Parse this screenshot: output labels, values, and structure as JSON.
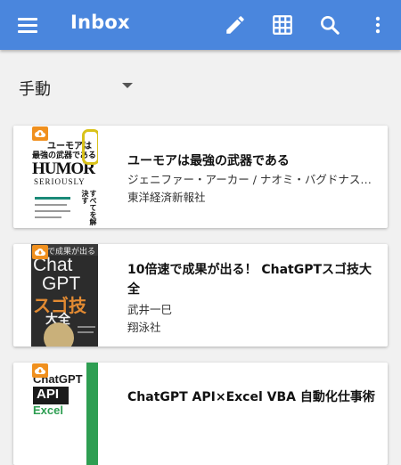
{
  "appbar": {
    "title": "Inbox",
    "menu_icon": "hamburger-menu-icon",
    "actions": [
      "edit-pencil-icon",
      "grid-view-icon",
      "search-icon",
      "more-vert-icon"
    ],
    "color": "#4a86dd"
  },
  "sort": {
    "label": "手動",
    "dropdown_icon": "caret-down-icon"
  },
  "books": [
    {
      "title": "ユーモアは最強の武器である",
      "author": "ジェニファー・アーカー / ナオミ・バグドナス…",
      "publisher": "東洋経済新報社",
      "badge_icon": "cloud-download-icon",
      "cover": {
        "line1": "ユーモアは",
        "line2": "最強の武器である",
        "main": "HUMOR",
        "sub": "SERIOUSLY",
        "tag": "すべてを解決す",
        "colors": [
          "#ffffff",
          "#111111",
          "#d9c21a",
          "#1a8a78"
        ]
      }
    },
    {
      "title": "10倍速で成果が出る！ ChatGPTスゴ技大全",
      "author": "武井一巳",
      "publisher": "翔泳社",
      "badge_icon": "cloud-download-icon",
      "cover": {
        "top": "で成果が出る",
        "main1": "Chat",
        "main2": "GPT",
        "jp": "スゴ技",
        "big": "大全",
        "colors": [
          "#2c2c2c",
          "#f2f2f2",
          "#e28a32",
          "#c9b07a"
        ]
      }
    },
    {
      "title": "ChatGPT API×Excel VBA 自動化仕事術",
      "author": "",
      "publisher": "",
      "badge_icon": "cloud-download-icon",
      "cover": {
        "main1": "ChatGPT",
        "main2": "API",
        "main3": "Excel",
        "colors": [
          "#ffffff",
          "#1b1b1b",
          "#2e9e52"
        ]
      }
    }
  ]
}
